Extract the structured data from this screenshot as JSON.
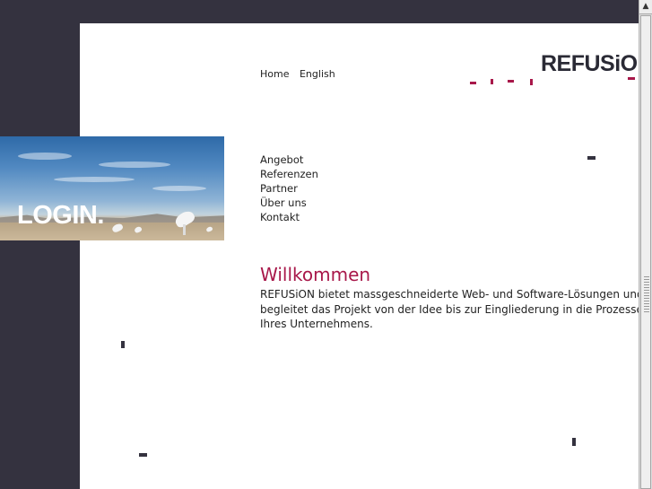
{
  "logo": {
    "text": "REFUSiON"
  },
  "banner": {
    "label": "LOGIN."
  },
  "topnav": [
    {
      "label": "Home"
    },
    {
      "label": "English"
    }
  ],
  "mainnav": [
    {
      "label": "Angebot"
    },
    {
      "label": "Referenzen"
    },
    {
      "label": "Partner"
    },
    {
      "label": "Über uns"
    },
    {
      "label": "Kontakt"
    }
  ],
  "welcome": {
    "title": "Willkommen",
    "body": "REFUSiON bietet massgeschneiderte Web- und Software-Lösungen und begleitet das Projekt von der Idee bis zur Eingliederung in die Prozesse Ihres Unternehmens."
  },
  "colors": {
    "accent": "#a8184a",
    "dark": "#34323f"
  },
  "scrollbar": {
    "up_icon": "arrow-up-icon"
  }
}
